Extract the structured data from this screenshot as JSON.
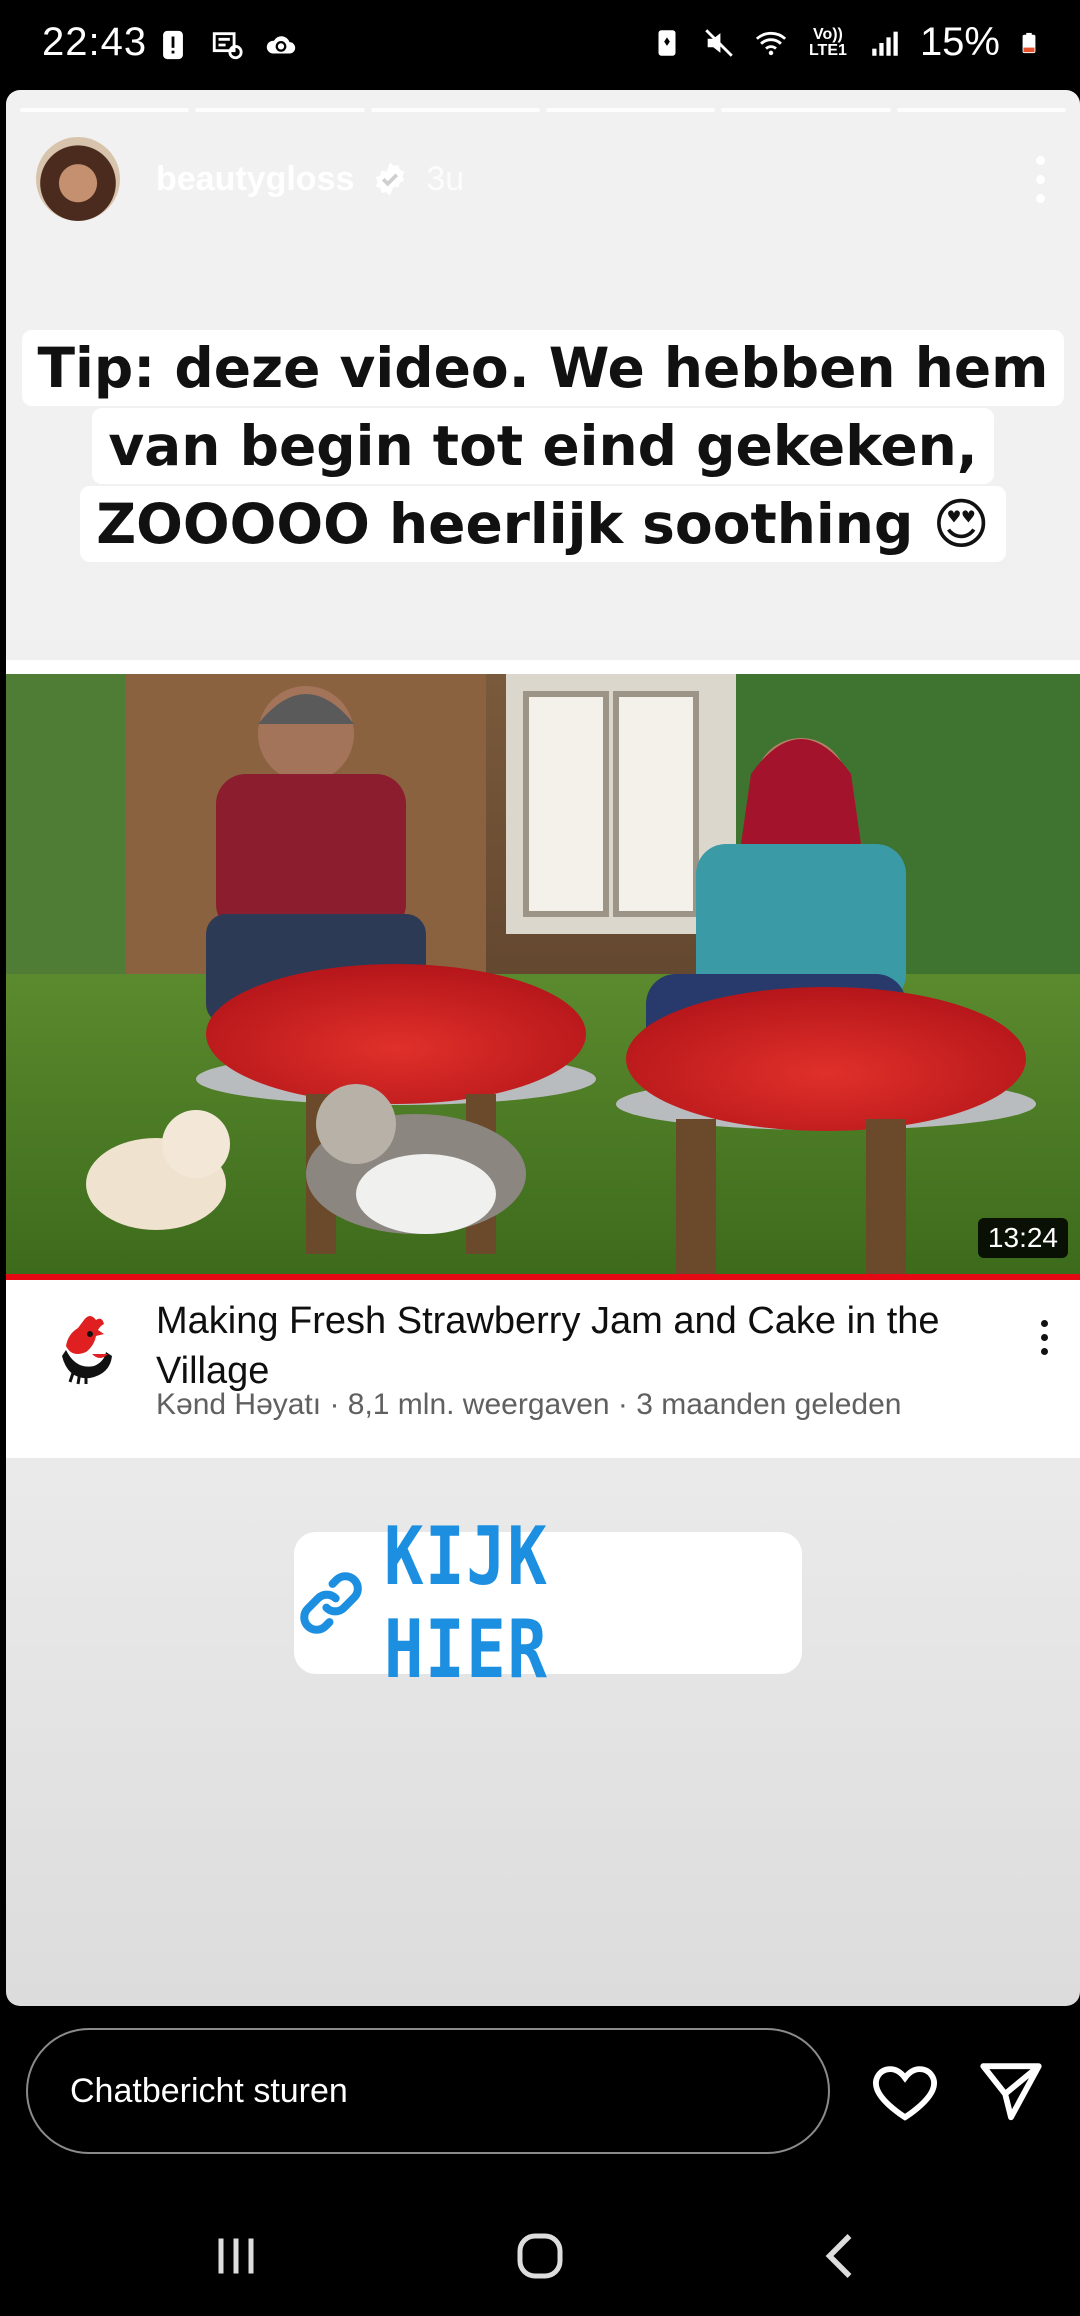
{
  "status_bar": {
    "time": "22:43",
    "network_label": "Vo)) LTE1",
    "battery_percent": "15%",
    "left_icons": [
      "alert-icon",
      "sim-data-icon",
      "cloud-sync-icon"
    ],
    "right_icons": [
      "battery-saver-icon",
      "mute-icon",
      "wifi-icon",
      "signal-icon",
      "battery-icon"
    ]
  },
  "story": {
    "progress_segments": 6,
    "username": "beautygloss",
    "verified": true,
    "time_ago": "3u",
    "caption_lines": [
      "Tip: deze video. We hebben hem",
      "van begin tot eind gekeken,",
      "ZOOOOO heerlijk soothing 😍"
    ]
  },
  "video": {
    "duration": "13:24",
    "title": "Making Fresh Strawberry Jam and Cake in the Village",
    "meta": "Kənd Həyatı · 8,1 mln. weergaven · 3 maanden geleden"
  },
  "link_sticker": {
    "label": "KIJK HIER",
    "color": "#1d8fe0"
  },
  "reply": {
    "placeholder": "Chatbericht sturen"
  },
  "colors": {
    "accent_red": "#e50914",
    "link_blue": "#1d8fe0"
  }
}
